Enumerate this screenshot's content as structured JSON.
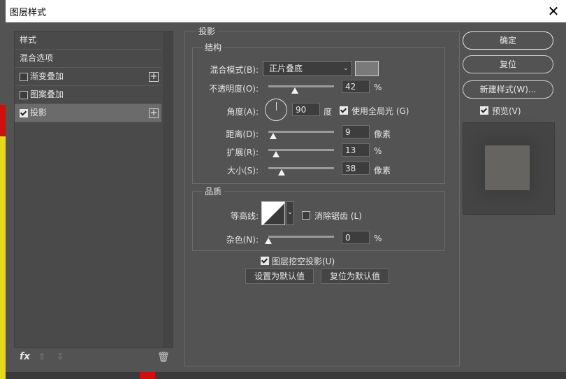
{
  "window": {
    "title": "图层样式",
    "close": "✕"
  },
  "left": {
    "items": [
      {
        "label": "样式",
        "checkbox": false,
        "checked": false,
        "plus": false,
        "selected": false
      },
      {
        "label": "混合选项",
        "checkbox": false,
        "checked": false,
        "plus": false,
        "selected": false
      },
      {
        "label": "渐变叠加",
        "checkbox": true,
        "checked": false,
        "plus": true,
        "selected": false
      },
      {
        "label": "图案叠加",
        "checkbox": true,
        "checked": false,
        "plus": false,
        "selected": false
      },
      {
        "label": "投影",
        "checkbox": true,
        "checked": true,
        "plus": true,
        "selected": true
      }
    ],
    "fx": "fx",
    "up": "⇧",
    "down": "⇩",
    "trash": "🗑"
  },
  "drop_shadow": {
    "title": "投影",
    "structure": {
      "title": "结构",
      "blend_mode_label": "混合模式(B):",
      "blend_mode_value": "正片叠底",
      "blend_color": "#7a7a7a",
      "opacity_label": "不透明度(O):",
      "opacity_value": "42",
      "opacity_unit": "%",
      "opacity_level": 0.42,
      "angle_label": "角度(A):",
      "angle_value": "90",
      "angle_unit": "度",
      "global_light_label": "使用全局光 (G)",
      "global_light_checked": true,
      "distance_label": "距离(D):",
      "distance_value": "9",
      "distance_unit": "像素",
      "spread_label": "扩展(R):",
      "spread_value": "13",
      "spread_unit": "%",
      "size_label": "大小(S):",
      "size_value": "38",
      "size_unit": "像素"
    },
    "quality": {
      "title": "品质",
      "contour_label": "等高线:",
      "antialias_label": "消除锯齿 (L)",
      "antialias_checked": false,
      "noise_label": "杂色(N):",
      "noise_value": "0",
      "noise_unit": "%"
    },
    "knockout_label": "图层挖空投影(U)",
    "knockout_checked": true,
    "set_default": "设置为默认值",
    "reset_default": "复位为默认值"
  },
  "right": {
    "ok": "确定",
    "reset": "复位",
    "new_style": "新建样式(W)...",
    "preview_label": "预览(V)",
    "preview_checked": true
  }
}
